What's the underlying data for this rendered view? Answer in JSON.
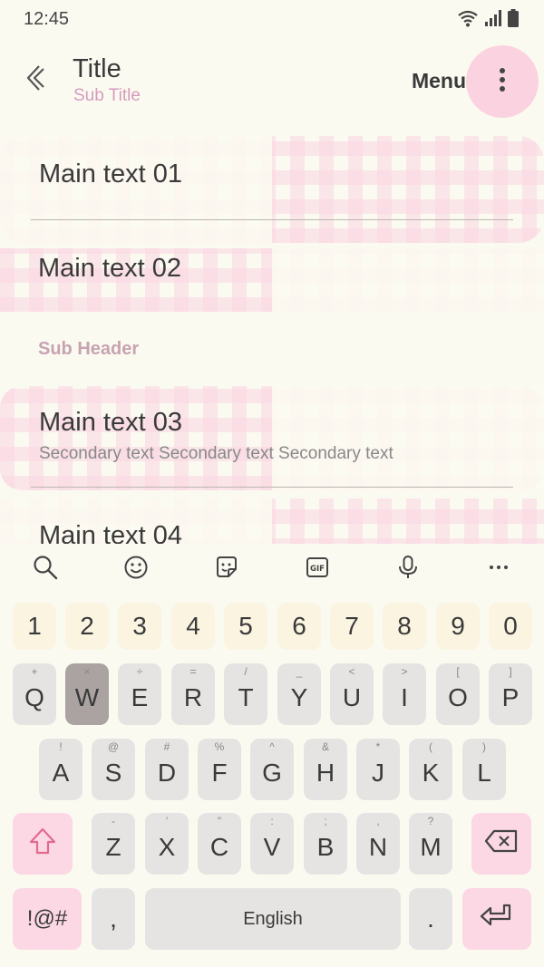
{
  "status_bar": {
    "time": "12:45",
    "icons": [
      "wifi-icon",
      "signal-icon",
      "battery-icon"
    ]
  },
  "app_bar": {
    "title": "Title",
    "subtitle": "Sub Title",
    "menu_label": "Menu",
    "back_icon": "chevron-left-icon",
    "more_icon": "more-vertical-icon"
  },
  "list": {
    "items": [
      {
        "main": "Main text 01"
      },
      {
        "main": "Main text 02"
      },
      {
        "main": "Main text 03",
        "secondary": "Secondary text Secondary text Secondary text"
      },
      {
        "main": "Main text 04"
      }
    ],
    "subheader": "Sub Header"
  },
  "keyboard": {
    "toolbar": [
      "search-icon",
      "emoji-icon",
      "sticker-icon",
      "gif-icon",
      "mic-icon",
      "more-horizontal-icon"
    ],
    "gif_label": "GIF",
    "numbers": [
      "1",
      "2",
      "3",
      "4",
      "5",
      "6",
      "7",
      "8",
      "9",
      "0"
    ],
    "row1": [
      {
        "key": "Q",
        "hint": "+"
      },
      {
        "key": "W",
        "hint": "×"
      },
      {
        "key": "E",
        "hint": "÷"
      },
      {
        "key": "R",
        "hint": "="
      },
      {
        "key": "T",
        "hint": "/"
      },
      {
        "key": "Y",
        "hint": "_"
      },
      {
        "key": "U",
        "hint": "<"
      },
      {
        "key": "I",
        "hint": ">"
      },
      {
        "key": "O",
        "hint": "["
      },
      {
        "key": "P",
        "hint": "]"
      }
    ],
    "row2": [
      {
        "key": "A",
        "hint": "!"
      },
      {
        "key": "S",
        "hint": "@"
      },
      {
        "key": "D",
        "hint": "#"
      },
      {
        "key": "F",
        "hint": "%"
      },
      {
        "key": "G",
        "hint": "^"
      },
      {
        "key": "H",
        "hint": "&"
      },
      {
        "key": "J",
        "hint": "*"
      },
      {
        "key": "K",
        "hint": "("
      },
      {
        "key": "L",
        "hint": ")"
      }
    ],
    "row3": [
      {
        "key": "Z",
        "hint": "-"
      },
      {
        "key": "X",
        "hint": "'"
      },
      {
        "key": "C",
        "hint": "\""
      },
      {
        "key": "V",
        "hint": ":"
      },
      {
        "key": "B",
        "hint": ";"
      },
      {
        "key": "N",
        "hint": ","
      },
      {
        "key": "M",
        "hint": "?"
      }
    ],
    "pressed_key": "W",
    "symbols_label": "!@#",
    "comma_label": ",",
    "space_label": "English",
    "period_label": ".",
    "accent_colors": {
      "pink": "#fbd8e4",
      "number_row": "#faf4e1",
      "key": "#e5e4e2",
      "pressed": "#aaa3a1"
    }
  }
}
